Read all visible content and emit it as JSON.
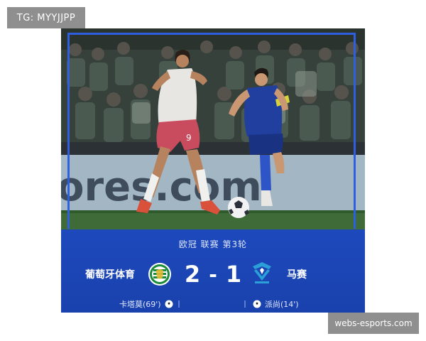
{
  "tag": {
    "text": "TG: MYYJJPP"
  },
  "photo": {
    "ad_board_text": "ores.com",
    "home_jersey_number": "9"
  },
  "match": {
    "competition": "欧冠 联赛 第3轮",
    "home_team": "葡萄牙体育",
    "away_team": "马赛",
    "home_score": "2",
    "separator": "-",
    "away_score": "1",
    "home_scorer": "卡塔莫(69')",
    "away_scorer": "派尚(14')",
    "home_crest_icon": "sporting-crest-icon",
    "away_crest_icon": "marseille-crest-icon"
  },
  "watermark": {
    "text": "webs-esports.com"
  },
  "colors": {
    "panel_blue": "#1d49bd",
    "frame_blue": "#2d5fe0",
    "sporting_green": "#1b8a3a",
    "marseille_blue": "#2a9fd8",
    "tag_gray": "#8f8f8f"
  }
}
